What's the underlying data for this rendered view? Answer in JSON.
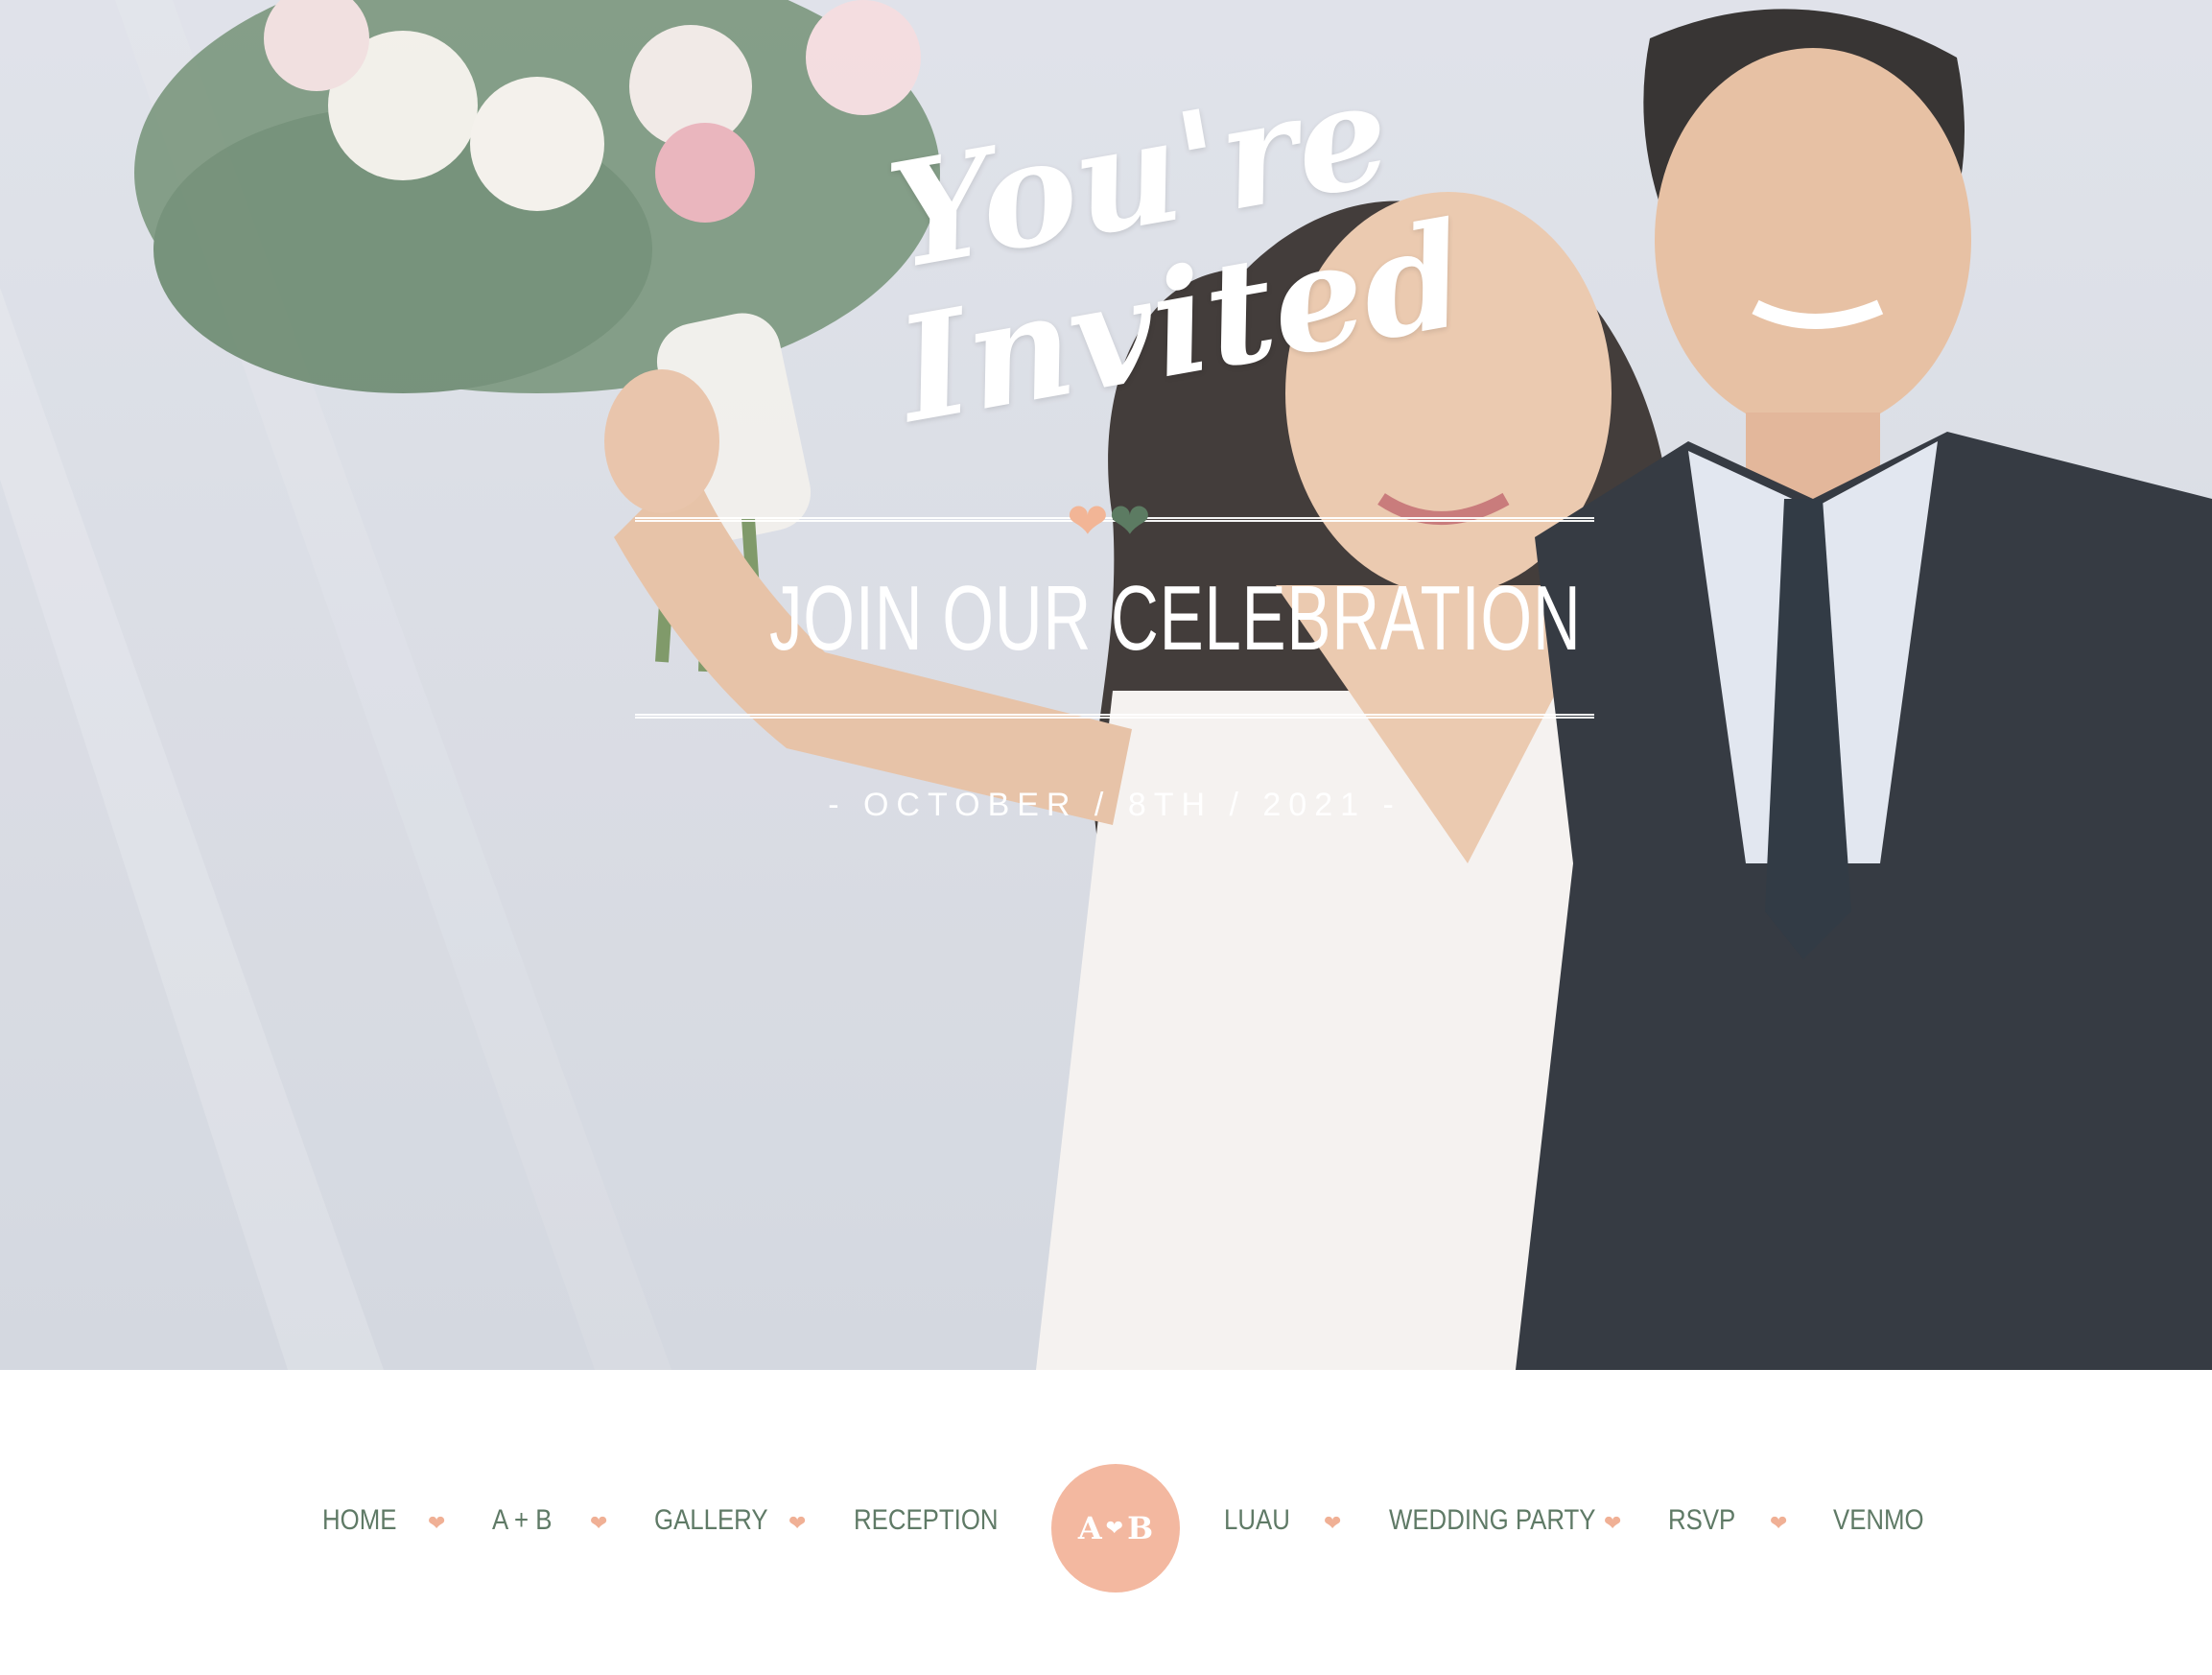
{
  "hero": {
    "script_line_1": "You're",
    "script_line_2": "Invited",
    "headline": "JOIN OUR CELEBRATION",
    "date": "- OCTOBER / 8TH / 2021 -",
    "heart_colors": {
      "peach": "#f2b596",
      "green": "#5c7b62"
    }
  },
  "nav": {
    "left_items": [
      "HOME",
      "A + B",
      "GALLERY",
      "RECEPTION"
    ],
    "right_items": [
      "LUAU",
      "WEDDING PARTY",
      "RSVP",
      "VENMO"
    ],
    "separator_icon": "heart-icon",
    "monogram": {
      "left": "A",
      "right": "B",
      "color": "#f3b8a0"
    },
    "text_color": "#5f7a66"
  }
}
